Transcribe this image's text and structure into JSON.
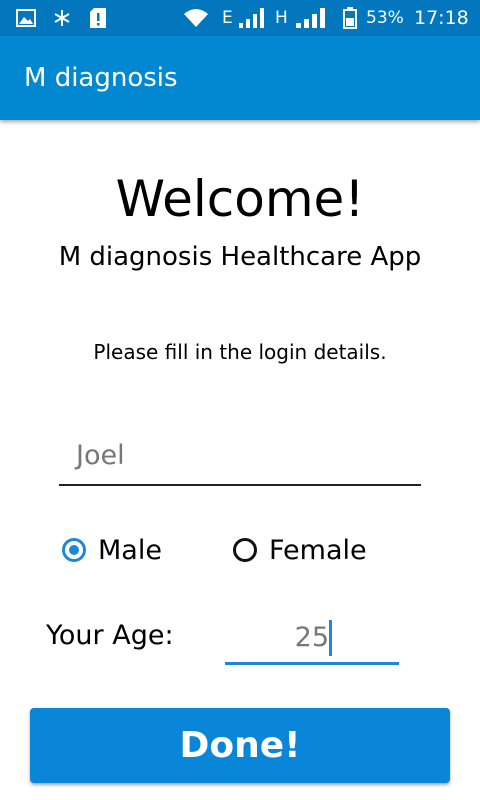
{
  "status_bar": {
    "network_e": "E",
    "network_h": "H",
    "battery_percent": "53%",
    "time": "17:18",
    "icons": [
      "image-icon",
      "snowflake-icon",
      "sim-alert-icon",
      "wifi-icon",
      "signal-icon",
      "signal-icon",
      "battery-icon"
    ]
  },
  "app_bar": {
    "title": "M diagnosis",
    "color": "#0288d1"
  },
  "main": {
    "welcome": "Welcome!",
    "subtitle": "M diagnosis Healthcare App",
    "instructions": "Please fill in the login details."
  },
  "form": {
    "name_value": "Joel",
    "gender_options": [
      {
        "label": "Male",
        "selected": true
      },
      {
        "label": "Female",
        "selected": false
      }
    ],
    "age_label": "Your Age:",
    "age_value": "25",
    "accent_color": "#1e88d7"
  },
  "actions": {
    "done_label": "Done!"
  }
}
